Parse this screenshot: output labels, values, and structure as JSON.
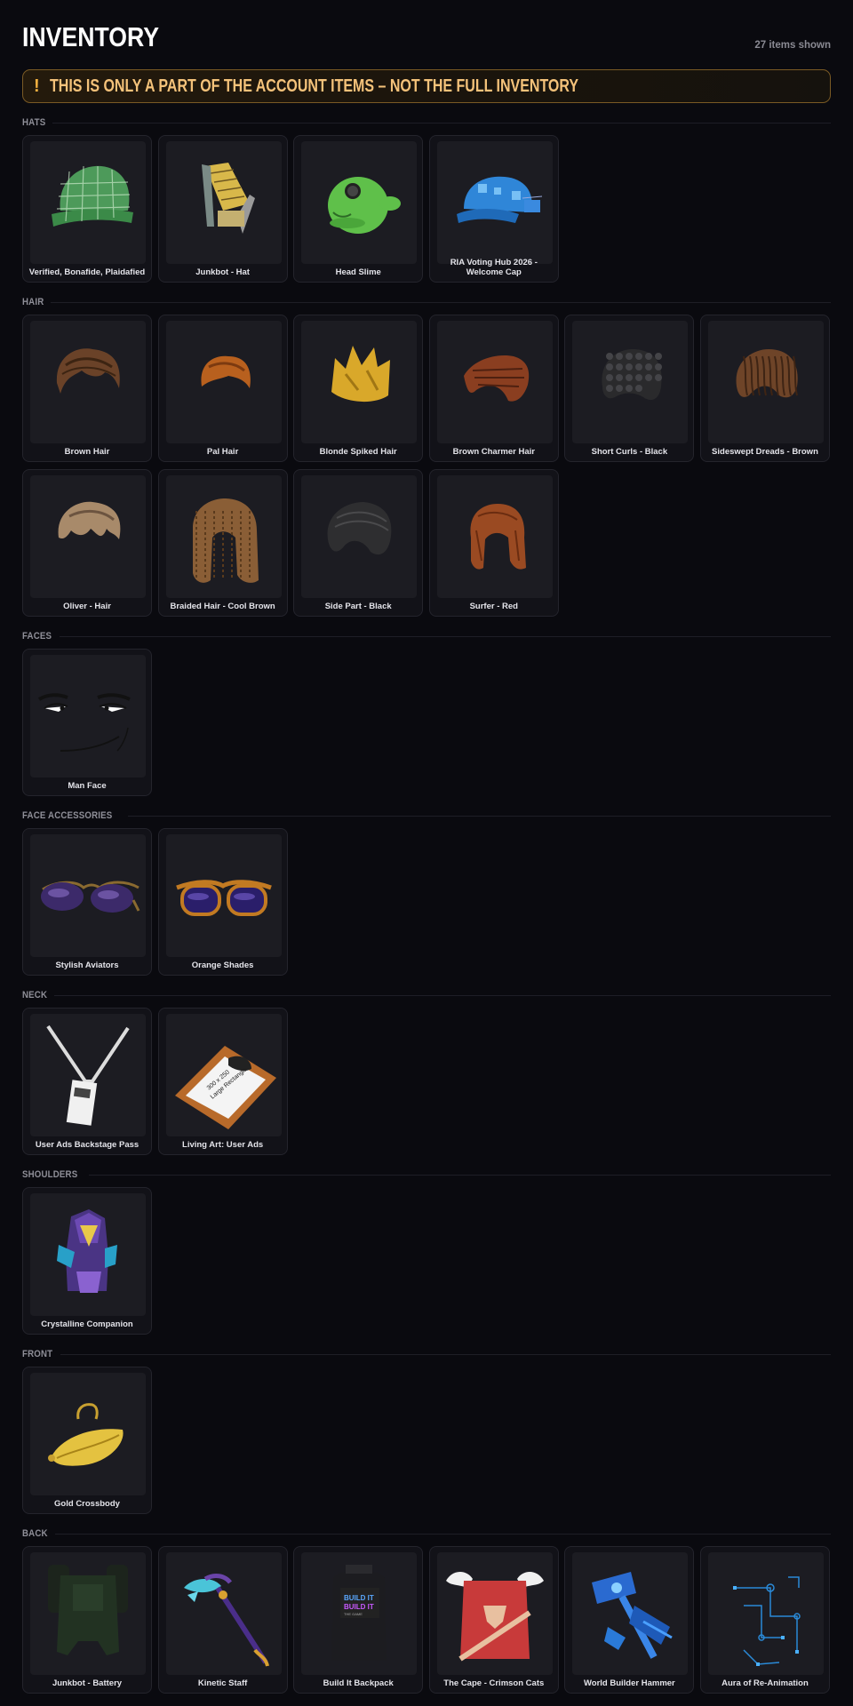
{
  "header": {
    "title": "INVENTORY",
    "count": "27 items shown"
  },
  "banner": {
    "icon": "!",
    "text": "THIS IS ONLY A PART OF THE ACCOUNT ITEMS – NOT THE FULL INVENTORY"
  },
  "sections": [
    {
      "label": "HATS",
      "items": [
        {
          "name": "Verified, Bonafide, Plaidafied",
          "icon": "plaid-cap-icon"
        },
        {
          "name": "Junkbot - Hat",
          "icon": "junkbot-hat-icon"
        },
        {
          "name": "Head Slime",
          "icon": "slime-icon"
        },
        {
          "name": "RIA Voting Hub 2026 - Welcome Cap",
          "icon": "blue-cap-icon"
        }
      ]
    },
    {
      "label": "HAIR",
      "items": [
        {
          "name": "Brown Hair",
          "icon": "hair-icon"
        },
        {
          "name": "Pal Hair",
          "icon": "hair-icon"
        },
        {
          "name": "Blonde Spiked Hair",
          "icon": "hair-icon"
        },
        {
          "name": "Brown Charmer Hair",
          "icon": "hair-icon"
        },
        {
          "name": "Short Curls - Black",
          "icon": "hair-icon"
        },
        {
          "name": "Sideswept Dreads - Brown",
          "icon": "hair-icon"
        },
        {
          "name": "Oliver - Hair",
          "icon": "hair-icon"
        },
        {
          "name": "Braided Hair - Cool Brown",
          "icon": "hair-icon"
        },
        {
          "name": "Side Part - Black",
          "icon": "hair-icon"
        },
        {
          "name": "Surfer - Red",
          "icon": "hair-icon"
        }
      ]
    },
    {
      "label": "FACES",
      "items": [
        {
          "name": "Man Face",
          "icon": "face-icon"
        }
      ]
    },
    {
      "label": "FACE ACCESSORIES",
      "items": [
        {
          "name": "Stylish Aviators",
          "icon": "sunglasses-icon"
        },
        {
          "name": "Orange Shades",
          "icon": "sunglasses-icon"
        }
      ]
    },
    {
      "label": "NECK",
      "items": [
        {
          "name": "User Ads Backstage Pass",
          "icon": "lanyard-icon"
        },
        {
          "name": "Living Art: User Ads",
          "icon": "framed-art-icon"
        }
      ]
    },
    {
      "label": "SHOULDERS",
      "items": [
        {
          "name": "Crystalline Companion",
          "icon": "companion-icon"
        }
      ]
    },
    {
      "label": "FRONT",
      "items": [
        {
          "name": "Gold Crossbody",
          "icon": "crossbody-bag-icon"
        }
      ]
    },
    {
      "label": "BACK",
      "items": [
        {
          "name": "Junkbot - Battery",
          "icon": "battery-icon"
        },
        {
          "name": "Kinetic Staff",
          "icon": "staff-icon"
        },
        {
          "name": "Build It Backpack",
          "icon": "backpack-icon"
        },
        {
          "name": "The Cape - Crimson Cats",
          "icon": "cape-icon"
        },
        {
          "name": "World Builder Hammer",
          "icon": "hammer-icon"
        },
        {
          "name": "Aura of Re-Animation",
          "icon": "aura-icon"
        }
      ]
    }
  ]
}
